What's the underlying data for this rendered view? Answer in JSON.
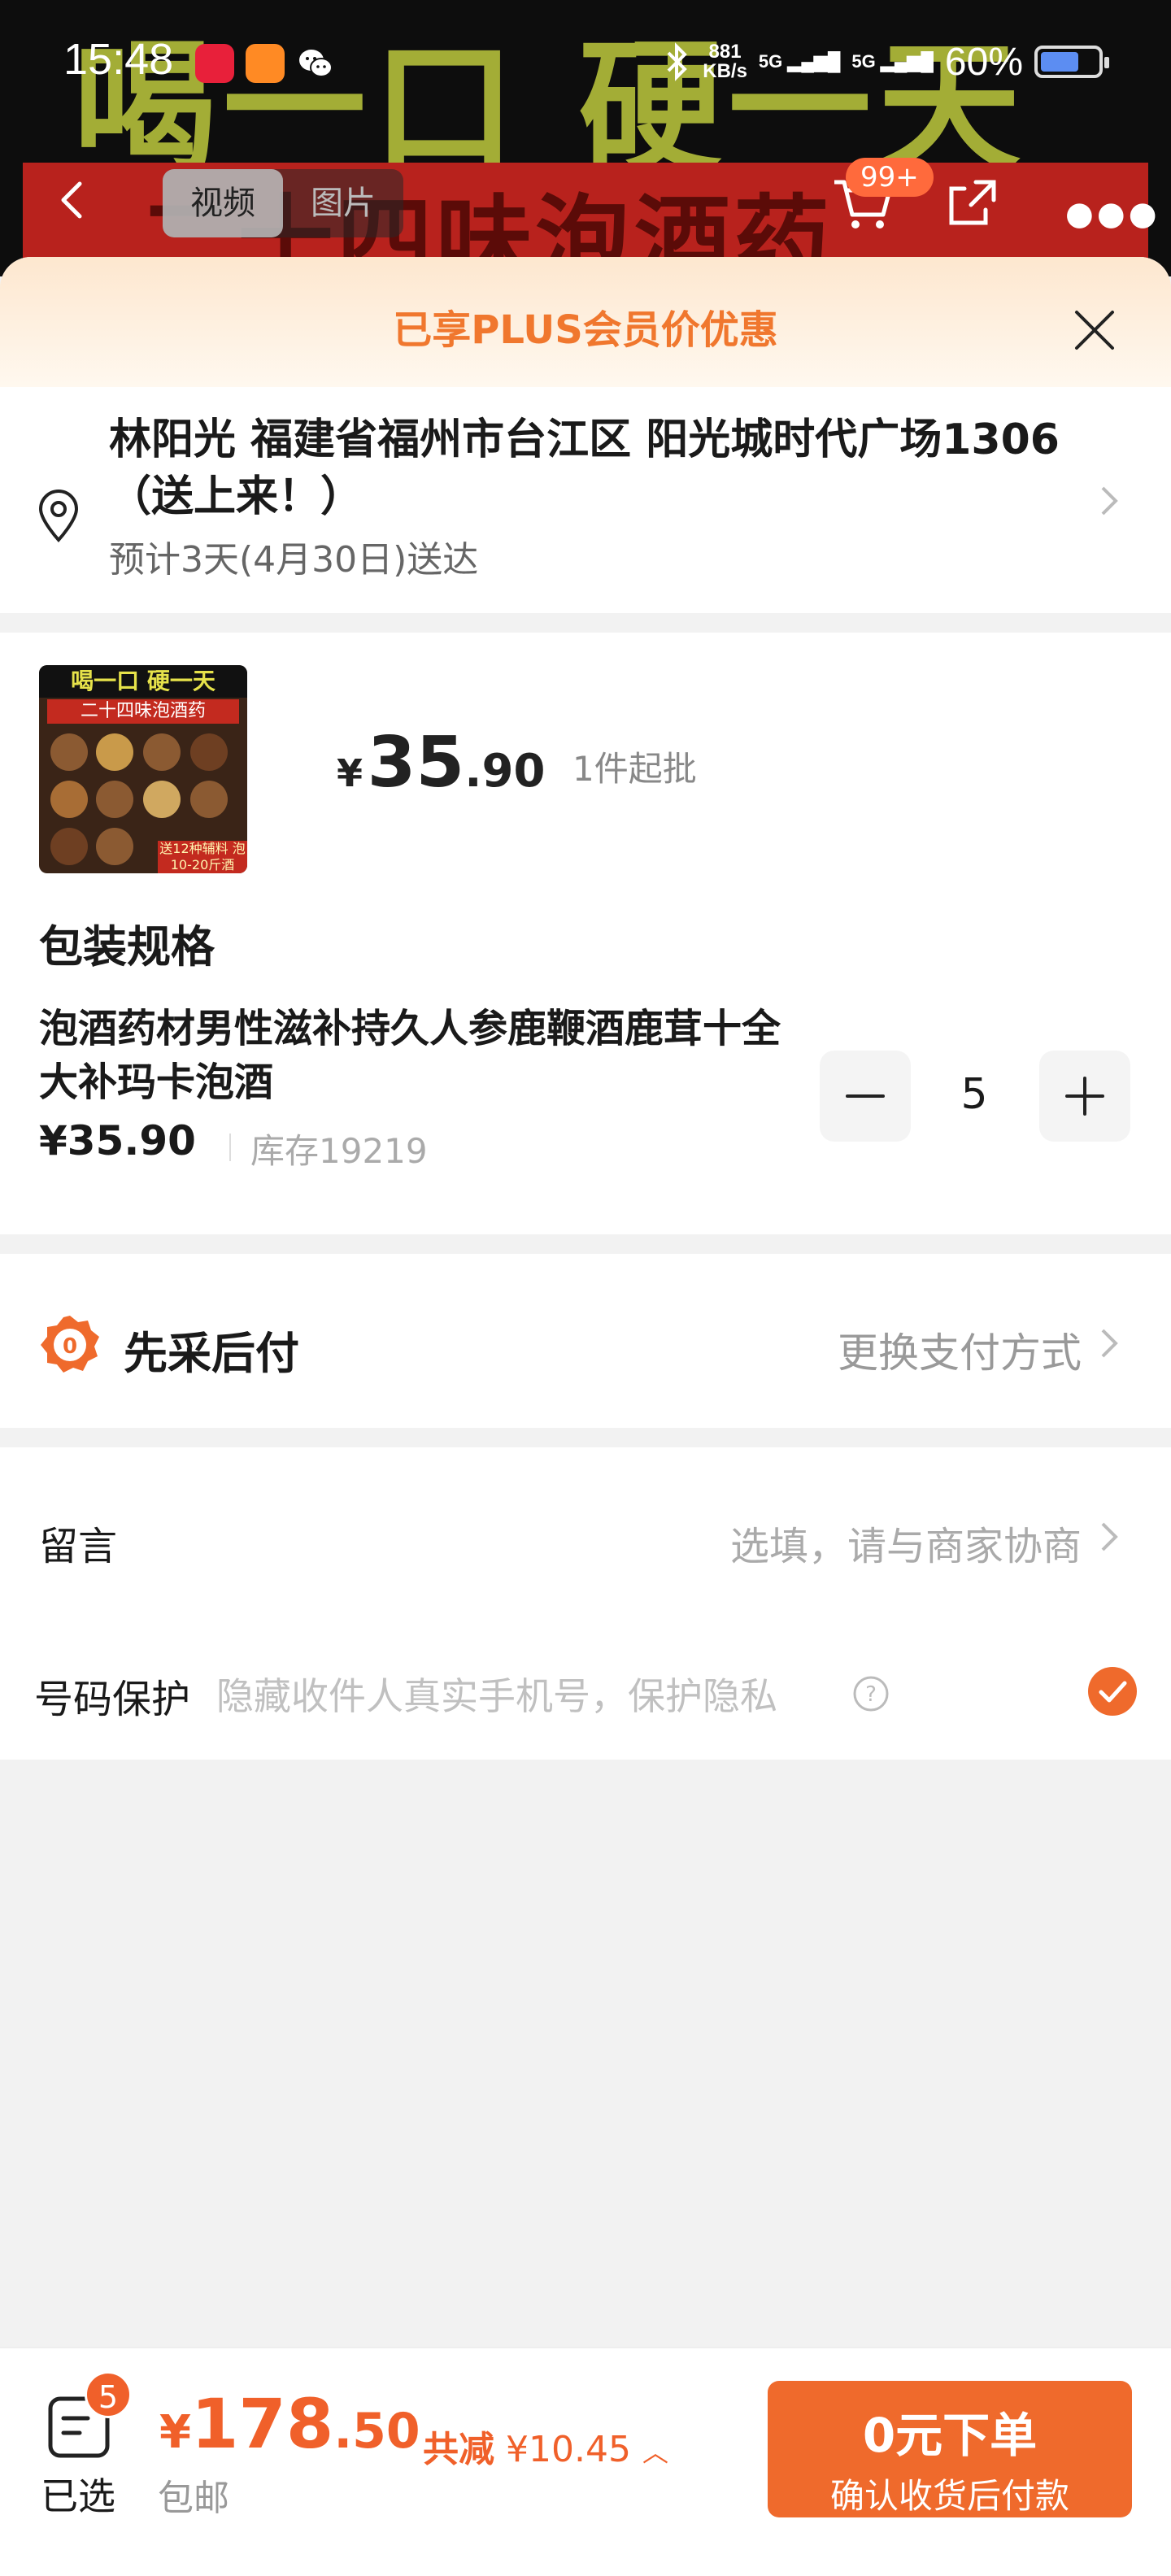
{
  "status_bar": {
    "time": "15:48",
    "net_speed_value": "881",
    "net_speed_unit": "KB/s",
    "sig1": "5G",
    "sig2": "5G",
    "battery": "60%"
  },
  "product_banner": {
    "headline": "喝一口 硬一天",
    "subline": "二十四味泡酒药"
  },
  "top_nav": {
    "tabs": [
      {
        "label": "视频",
        "active": true
      },
      {
        "label": "图片",
        "active": false
      }
    ],
    "cart_badge": "99+"
  },
  "sheet": {
    "plus_banner": "已享PLUS会员价优惠",
    "address": {
      "line": "林阳光 福建省福州市台江区 阳光城时代广场1306（送上来！）",
      "eta": "预计3天(4月30日)送达"
    },
    "product": {
      "image_top": "喝一口 硬一天",
      "image_red": "二十四味泡酒药",
      "image_foot": "送12种辅料 泡10-20斤酒",
      "price_currency": "¥",
      "price_int": "35",
      "price_dec": ".90",
      "min_order": "1件起批",
      "section_title": "包装规格",
      "sku": {
        "name": "泡酒药材男性滋补持久人参鹿鞭酒鹿茸十全大补玛卡泡酒",
        "price": "¥35.90",
        "stock": "库存19219",
        "quantity": "5"
      }
    },
    "payment": {
      "title": "先采后付",
      "change_label": "更换支付方式"
    },
    "message": {
      "label": "留言",
      "hint": "选填，请与商家协商"
    },
    "privacy": {
      "label": "号码保护",
      "hint": "隐藏收件人真实手机号，保护隐私",
      "checked": true
    }
  },
  "bottom_bar": {
    "selected_count": "5",
    "selected_label": "已选",
    "total_currency": "¥",
    "total_int": "178",
    "total_dec": ".50",
    "discount_label": "共减",
    "discount_value": "¥10.45",
    "shipping": "包邮",
    "order_button": "0元下单",
    "order_subtitle": "确认收货后付款"
  },
  "colors": {
    "accent": "#ef6a2c",
    "plus_text": "#f0772e"
  }
}
